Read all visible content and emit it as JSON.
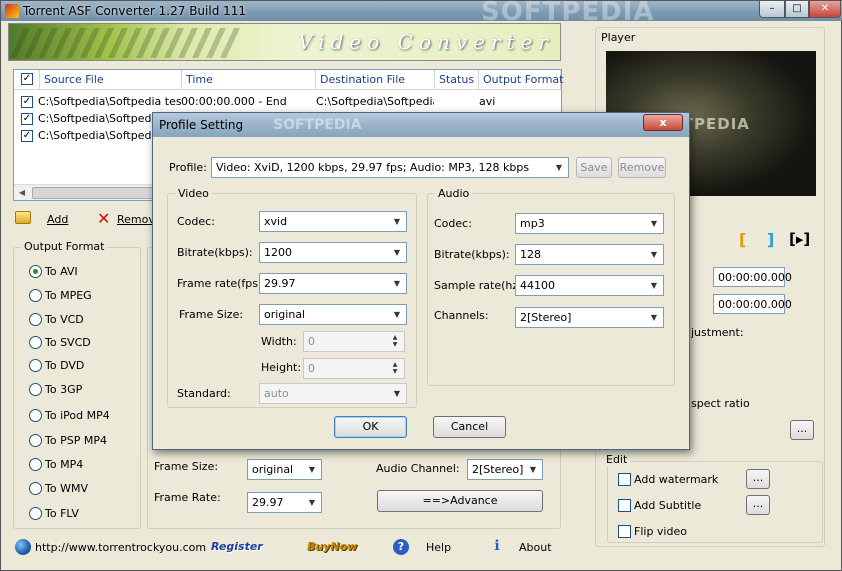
{
  "window": {
    "title": "Torrent ASF Converter 1.27 Build 111",
    "watermark": "SOFTPEDIA",
    "controls": {
      "minimize": "–",
      "maximize": "□",
      "close": "✕"
    }
  },
  "banner": {
    "title": "Video Converter"
  },
  "file_list": {
    "columns": [
      "Source File",
      "Time",
      "Destination File",
      "Status",
      "Output Format"
    ],
    "rows": [
      {
        "checked": true,
        "source": "C:\\Softpedia\\Softpedia test.avi",
        "time": "00:00:00.000 - End",
        "dest": "C:\\Softpedia\\Softpedia t",
        "status": "",
        "format": "avi"
      },
      {
        "checked": true,
        "source": "C:\\Softpedia\\Softpedia",
        "time": "",
        "dest": "",
        "status": "",
        "format": "avi"
      },
      {
        "checked": true,
        "source": "C:\\Softpedia\\Softpedia",
        "time": "",
        "dest": "",
        "status": "",
        "format": ""
      }
    ]
  },
  "toolbar": {
    "add_label": "Add",
    "remove_label": "Remov"
  },
  "output_format": {
    "title": "Output Format",
    "selected": "To AVI",
    "options": [
      "To AVI",
      "To MPEG",
      "To VCD",
      "To SVCD",
      "To DVD",
      "To 3GP",
      "To iPod MP4",
      "To PSP MP4",
      "To MP4",
      "To WMV",
      "To FLV"
    ]
  },
  "main_settings": {
    "frame_size_label": "Frame Size:",
    "frame_size_value": "original",
    "frame_rate_label": "Frame Rate:",
    "frame_rate_value": "29.97",
    "audio_channel_label": "Audio Channel:",
    "audio_channel_value": "2[Stereo]",
    "advance_label": "==>Advance"
  },
  "player": {
    "title": "Player",
    "start_time": "00:00:00.000",
    "end_time": "00:00:00.000",
    "adjustment_label": "justment:",
    "aspect_label": "spect ratio",
    "aspect_btn": "...",
    "mark_in": "[",
    "mark_out": "]",
    "play_sel": "[▸]"
  },
  "edit": {
    "title": "Edit",
    "watermark_label": "Add watermark",
    "subtitle_label": "Add Subtitle",
    "flip_label": "Flip video",
    "browse": "..."
  },
  "footer": {
    "url": "http://www.torrentrockyou.com",
    "register": "Register",
    "buynow": "BuyNow",
    "help": "Help",
    "about": "About"
  },
  "dialog": {
    "title": "Profile Setting",
    "watermark": "SOFTPEDIA",
    "close": "x",
    "profile_label": "Profile:",
    "profile_value": "Video: XviD, 1200 kbps, 29.97 fps;  Audio: MP3, 128 kbps",
    "save": "Save",
    "remove": "Remove",
    "video": {
      "title": "Video",
      "codec_label": "Codec:",
      "codec_value": "xvid",
      "bitrate_label": "Bitrate(kbps):",
      "bitrate_value": "1200",
      "framerate_label": "Frame rate(fps):",
      "framerate_value": "29.97",
      "framesize_label": "Frame Size:",
      "framesize_value": "original",
      "width_label": "Width:",
      "width_value": "0",
      "height_label": "Height:",
      "height_value": "0",
      "standard_label": "Standard:",
      "standard_value": "auto"
    },
    "audio": {
      "title": "Audio",
      "codec_label": "Codec:",
      "codec_value": "mp3",
      "bitrate_label": "Bitrate(kbps):",
      "bitrate_value": "128",
      "samplerate_label": "Sample rate(hz):",
      "samplerate_value": "44100",
      "channels_label": "Channels:",
      "channels_value": "2[Stereo]"
    },
    "ok": "OK",
    "cancel": "Cancel"
  }
}
